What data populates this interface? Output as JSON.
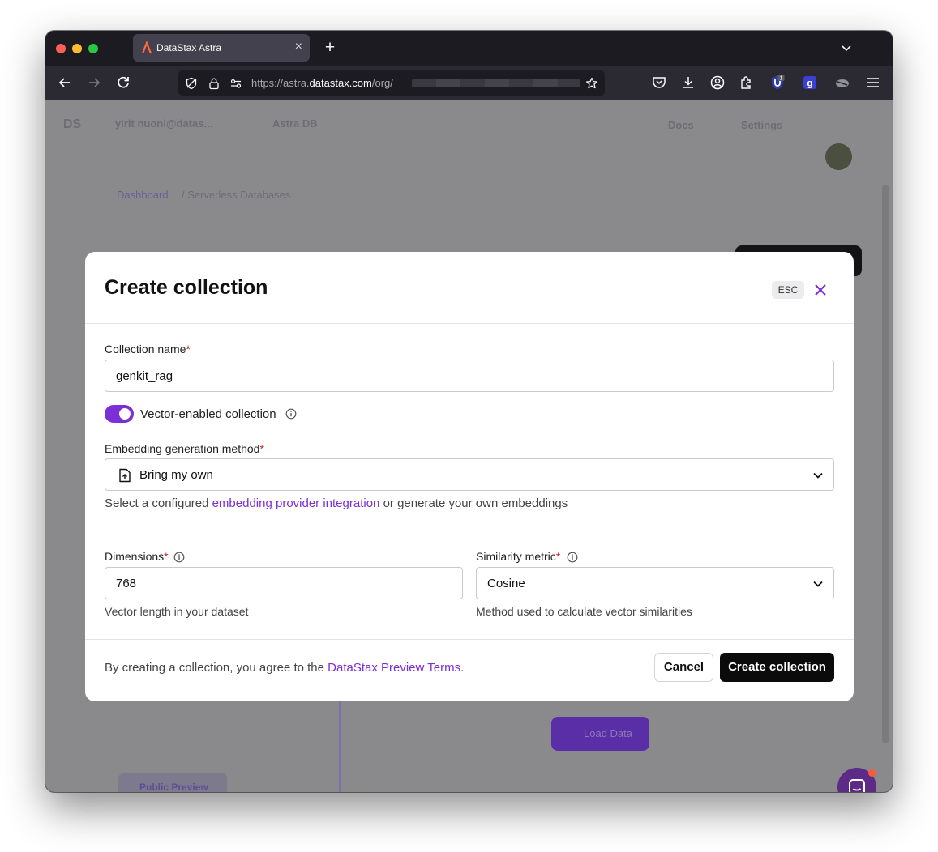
{
  "browser": {
    "tab_title": "DataStax Astra",
    "url_prefix": "https://astra.",
    "url_host": "datastax.com",
    "url_path": "/org/",
    "extension_badge": "1"
  },
  "background": {
    "user_label": "yirit nuoni@datas...",
    "db_label": "Astra DB",
    "docs_label": "Docs",
    "settings_label": "Settings",
    "breadcrumb_link": "Dashboard",
    "breadcrumb_rest": "/ Serverless Databases",
    "load_data_label": "Load Data",
    "preview_label": "Public Preview"
  },
  "modal": {
    "title": "Create collection",
    "esc_label": "ESC",
    "collection_name_label": "Collection name",
    "collection_name_value": "genkit_rag",
    "required_mark": "*",
    "vector_toggle_label": "Vector-enabled collection",
    "embedding_label": "Embedding generation method",
    "embedding_value": "Bring my own",
    "embedding_help_prefix": "Select a configured ",
    "embedding_help_link": "embedding provider integration",
    "embedding_help_suffix": " or generate your own embeddings",
    "dimensions_label": "Dimensions",
    "dimensions_value": "768",
    "dimensions_help": "Vector length in your dataset",
    "similarity_label": "Similarity metric",
    "similarity_value": "Cosine",
    "similarity_help": "Method used to calculate vector similarities",
    "terms_prefix": "By creating a collection, you agree to the ",
    "terms_link": "DataStax Preview Terms",
    "terms_suffix": ".",
    "cancel_label": "Cancel",
    "create_label": "Create collection"
  },
  "colors": {
    "accent": "#7b2fd6",
    "primary_button": "#0b0b0c",
    "required": "#d0231e",
    "overlay": "#8a8a8d"
  },
  "icons": {
    "upload": "file-upload-icon",
    "info": "info-icon",
    "chevron": "chevron-down-icon",
    "close": "close-icon"
  }
}
